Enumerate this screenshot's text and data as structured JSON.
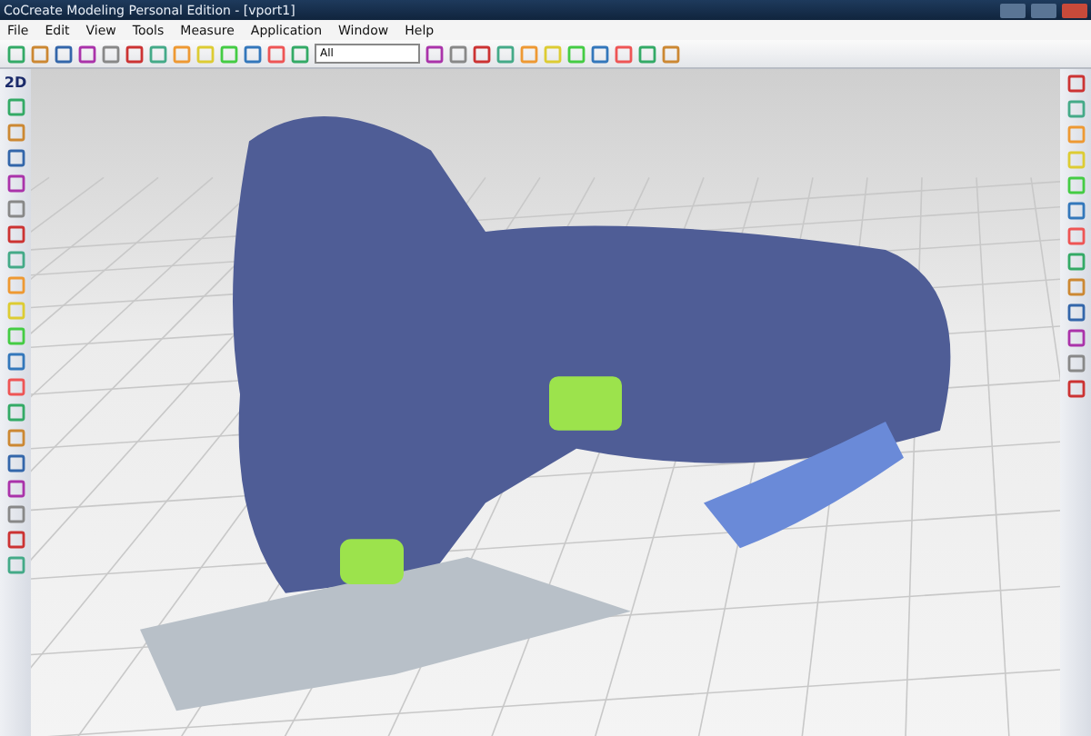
{
  "window": {
    "title": "CoCreate Modeling Personal Edition - [vport1]"
  },
  "menu": [
    "File",
    "Edit",
    "View",
    "Tools",
    "Measure",
    "Application",
    "Window",
    "Help"
  ],
  "toolbar": {
    "filter_dropdown": "All"
  },
  "left_toolbar": {
    "mode_label": "2D"
  }
}
